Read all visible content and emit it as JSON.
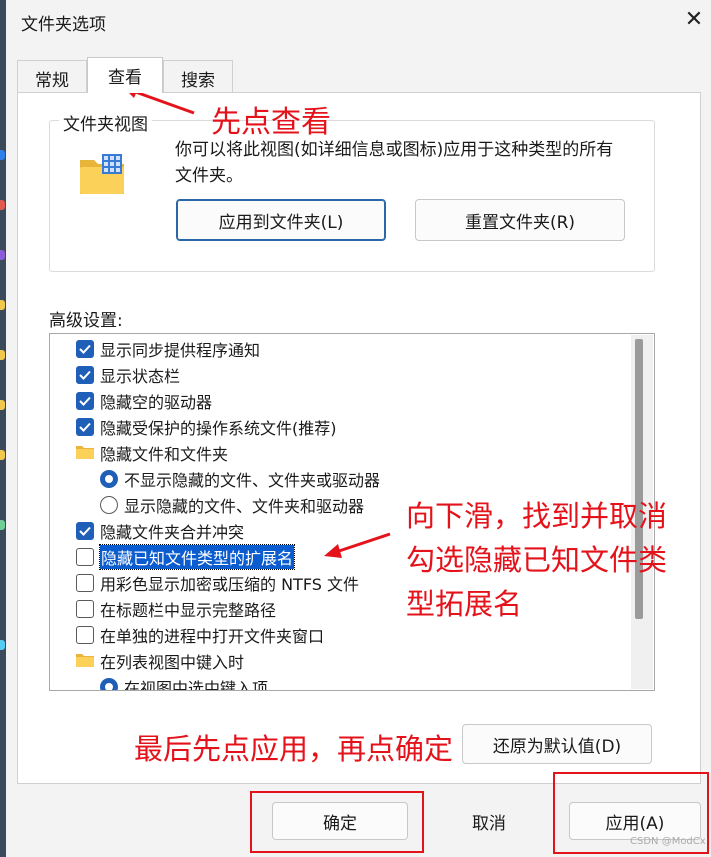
{
  "window": {
    "title": "文件夹选项"
  },
  "tabs": [
    {
      "label": "常规",
      "active": false
    },
    {
      "label": "查看",
      "active": true
    },
    {
      "label": "搜索",
      "active": false
    }
  ],
  "folder_views": {
    "title": "文件夹视图",
    "description_line1": "你可以将此视图(如详细信息或图标)应用于这种类型的所有",
    "description_line2": "文件夹。",
    "apply_label": "应用到文件夹(L)",
    "reset_label": "重置文件夹(R)"
  },
  "advanced": {
    "title": "高级设置:",
    "items": [
      {
        "type": "checkbox",
        "checked": true,
        "label": "显示同步提供程序通知"
      },
      {
        "type": "checkbox",
        "checked": true,
        "label": "显示状态栏"
      },
      {
        "type": "checkbox",
        "checked": true,
        "label": "隐藏空的驱动器"
      },
      {
        "type": "checkbox",
        "checked": true,
        "label": "隐藏受保护的操作系统文件(推荐)"
      },
      {
        "type": "folder",
        "label": "隐藏文件和文件夹"
      },
      {
        "type": "radio",
        "checked": true,
        "label": "不显示隐藏的文件、文件夹或驱动器"
      },
      {
        "type": "radio",
        "checked": false,
        "label": "显示隐藏的文件、文件夹和驱动器"
      },
      {
        "type": "checkbox",
        "checked": true,
        "label": "隐藏文件夹合并冲突"
      },
      {
        "type": "checkbox",
        "checked": false,
        "label": "隐藏已知文件类型的扩展名",
        "highlighted": true
      },
      {
        "type": "checkbox",
        "checked": false,
        "label": "用彩色显示加密或压缩的 NTFS 文件"
      },
      {
        "type": "checkbox",
        "checked": false,
        "label": "在标题栏中显示完整路径"
      },
      {
        "type": "checkbox",
        "checked": false,
        "label": "在单独的进程中打开文件夹窗口"
      },
      {
        "type": "folder",
        "label": "在列表视图中键入时"
      },
      {
        "type": "radio",
        "checked": true,
        "label": "在视图中选中键入项"
      }
    ],
    "restore_defaults_label": "还原为默认值(D)"
  },
  "footer": {
    "ok_label": "确定",
    "cancel_label": "取消",
    "apply_label": "应用(A)"
  },
  "annotations": {
    "step1": "先点查看",
    "step2_line1": "向下滑，找到并取消",
    "step2_line2": "勾选隐藏已知文件类",
    "step2_line3": "型拓展名",
    "step3": "最后先点应用，再点确定"
  },
  "watermark": "CSDN @ModCx",
  "colors": {
    "accent": "#1f5fb8",
    "selection": "#0a5ccf",
    "annotation": "#e4131b"
  }
}
